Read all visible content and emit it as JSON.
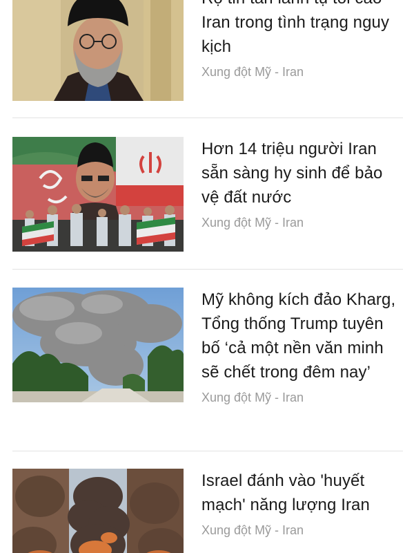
{
  "articles": [
    {
      "title": "Rộ tin tân lãnh tụ tối cao Iran trong tình trạng nguy kịch",
      "category": "Xung đột Mỹ - Iran",
      "image": "portrait-cleric-black-turban"
    },
    {
      "title": "Hơn 14 triệu người Iran sẵn sàng hy sinh để bảo vệ đất nước",
      "category": "Xung đột Mỹ - Iran",
      "image": "mural-with-iranian-flags-and-crowd"
    },
    {
      "title": "Mỹ không kích đảo Kharg, Tổng thống Trump tuyên bố ‘cả một nền văn minh sẽ chết trong đêm nay’",
      "category": "Xung đột Mỹ - Iran",
      "image": "smoke-plume-over-trees"
    },
    {
      "title": "Israel đánh vào 'huyết mạch' năng lượng Iran",
      "category": "Xung đột Mỹ - Iran",
      "image": "explosion-fireball-collage"
    }
  ]
}
